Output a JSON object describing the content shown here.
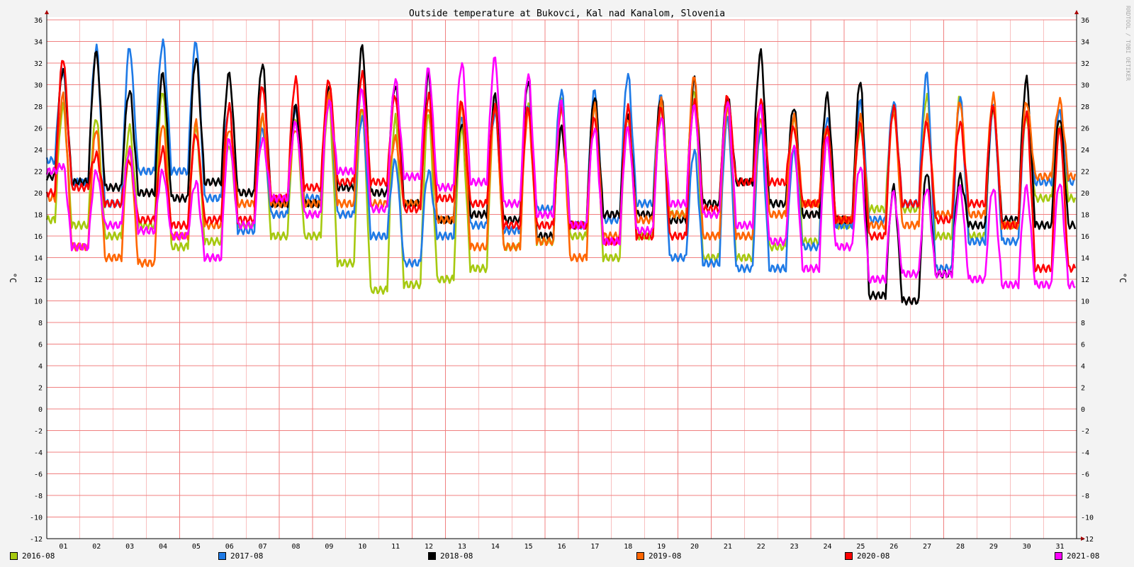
{
  "watermark": "RRDTOOL / TOBI OETIKER",
  "chart_data": {
    "type": "line",
    "title": "Outside temperature at Bukovci, Kal nad Kanalom, Slovenia",
    "ylabel": "°C",
    "ylim": [
      -12,
      36
    ],
    "ytick_step": 2,
    "xlim": [
      0,
      31
    ],
    "categories": [
      "01",
      "02",
      "03",
      "04",
      "05",
      "06",
      "07",
      "08",
      "09",
      "10",
      "11",
      "12",
      "13",
      "14",
      "15",
      "16",
      "17",
      "18",
      "19",
      "20",
      "21",
      "22",
      "23",
      "24",
      "25",
      "26",
      "27",
      "28",
      "29",
      "30",
      "31"
    ],
    "grid": true,
    "legend_position": "bottom",
    "series": [
      {
        "name": "2016-08",
        "color": "#a6c90f",
        "min": [
          17.5,
          17,
          16,
          17,
          15,
          15.5,
          17,
          16,
          16,
          13.5,
          11,
          11.5,
          12,
          13,
          15,
          15.5,
          16,
          14,
          16,
          18,
          14,
          14,
          15,
          15.5,
          17,
          18.5,
          18.5,
          16,
          16,
          17,
          19.5
        ],
        "max": [
          28,
          27,
          26,
          29.5,
          26,
          24.5,
          27,
          27,
          28.5,
          28,
          27,
          27.5,
          26,
          28,
          28,
          29,
          28,
          27.5,
          28,
          29.5,
          28,
          27,
          27,
          26,
          26,
          28,
          29,
          29,
          28,
          27,
          26
        ]
      },
      {
        "name": "2017-08",
        "color": "#1e7ae6",
        "min": [
          23,
          21,
          19,
          22,
          22,
          19.5,
          16.5,
          18,
          19.5,
          18,
          16,
          13.5,
          16,
          17,
          16.5,
          18.5,
          17,
          17.5,
          19,
          14,
          13.5,
          13,
          13,
          15,
          17,
          17.5,
          19,
          13,
          15.5,
          15.5,
          21
        ],
        "max": [
          31.5,
          33.5,
          33.5,
          34,
          34,
          28,
          26,
          28,
          29,
          27,
          23,
          22,
          27,
          27.5,
          28,
          29.5,
          29.5,
          31,
          29,
          24,
          27,
          26,
          24,
          27,
          28.5,
          28.5,
          31,
          29,
          28,
          27.5,
          27.5
        ]
      },
      {
        "name": "2018-08",
        "color": "#000000",
        "min": [
          21.5,
          21,
          20.5,
          20,
          19.5,
          21,
          20,
          19,
          19,
          20.5,
          20,
          19,
          17.5,
          18,
          17.5,
          16,
          17,
          18,
          18,
          17.5,
          19,
          21,
          19,
          18,
          17.5,
          10.5,
          10,
          12.5,
          17,
          17.5,
          17
        ]
      },
      {
        "name": "2019-08",
        "color": "#ff6600",
        "min": [
          19.5,
          15,
          14,
          13.5,
          16,
          17,
          19,
          19,
          19,
          19,
          19,
          19,
          17.5,
          15,
          15,
          15.5,
          14,
          16,
          17.5,
          18,
          16,
          16,
          18,
          19,
          17.5,
          17,
          17,
          18,
          18,
          17,
          21.5
        ],
        "max": [
          29,
          26,
          24,
          26.5,
          26.5,
          26,
          27,
          26,
          29,
          28,
          25,
          28,
          28,
          28,
          27.5,
          28,
          28,
          27,
          28.5,
          31,
          28,
          27,
          27,
          26,
          27,
          27.5,
          27,
          28.5,
          29,
          28.5,
          28.5
        ]
      },
      {
        "name": "2020-08",
        "color": "#ff0000",
        "min": [
          20,
          20.5,
          19,
          17.5,
          17,
          17.5,
          17.5,
          19.5,
          20.5,
          21,
          21,
          18.5,
          19.5,
          19,
          17,
          17,
          17,
          15.5,
          16,
          16,
          18.5,
          21,
          21,
          19,
          17.5,
          16,
          19,
          17.5,
          19,
          17,
          13
        ],
        "max": [
          32.5,
          23.5,
          23,
          24,
          25.5,
          28,
          30,
          30.5,
          30.5,
          31,
          29,
          29,
          28.5,
          28,
          28,
          28,
          27,
          28,
          28,
          28.5,
          29,
          28.5,
          26,
          26,
          26.5,
          28,
          26.5,
          26.5,
          28,
          27.5,
          26
        ]
      },
      {
        "name": "2021-08",
        "color": "#ff00ff",
        "min": [
          22,
          15,
          17,
          16.5,
          16,
          14,
          17,
          19.5,
          18,
          22,
          18.5,
          21.5,
          20.5,
          21,
          19,
          18,
          17,
          15.5,
          16.5,
          19,
          18,
          17,
          15.5,
          13,
          15,
          12,
          12.5,
          12.5,
          12,
          11.5,
          11.5
        ],
        "max": [
          22.5,
          22,
          24,
          22,
          21,
          25,
          25,
          26.5,
          28.5,
          29.5,
          30.5,
          31.5,
          32,
          32.5,
          31,
          28.5,
          26,
          26,
          27,
          28,
          28.5,
          28,
          24.5,
          25,
          22.5,
          20,
          20.5,
          20.5,
          20.5,
          20.5,
          21
        ]
      }
    ]
  }
}
